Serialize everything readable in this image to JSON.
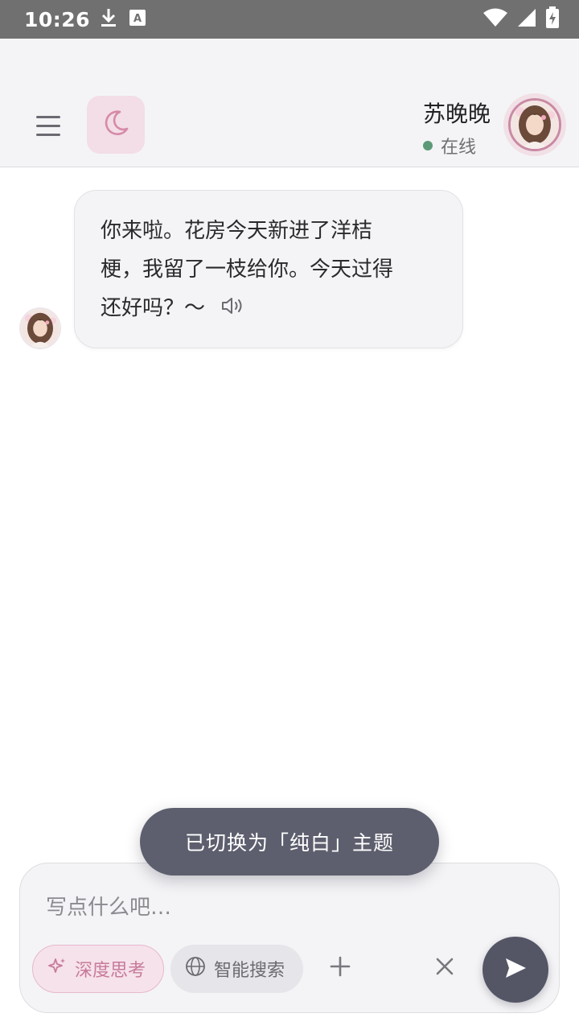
{
  "status_bar": {
    "time": "10:26",
    "left_icons": [
      "download-icon",
      "keyboard-a-icon"
    ],
    "right_icons": [
      "wifi-icon",
      "signal-icon",
      "battery-charging-icon"
    ]
  },
  "header": {
    "menu_icon": "menu-icon",
    "theme_icon": "moon-icon",
    "contact_name": "苏晚晚",
    "contact_status": "在线",
    "status_color": "#5c9a77",
    "accent_color": "#c98aa4"
  },
  "messages": [
    {
      "sender": "assistant",
      "lines": [
        "你来啦。花房今天新进了洋桔",
        "梗，我留了一枝给你。今天过得",
        "还好吗？〜"
      ],
      "speaker_icon": "speaker-icon"
    }
  ],
  "toast": {
    "text": "已切换为「纯白」主题"
  },
  "composer": {
    "placeholder": "写点什么吧…",
    "deep_think_label": "深度思考",
    "smart_search_label": "智能搜索",
    "icons": [
      "sparkle-icon",
      "globe-icon",
      "plus-icon",
      "close-icon",
      "send-icon"
    ]
  }
}
